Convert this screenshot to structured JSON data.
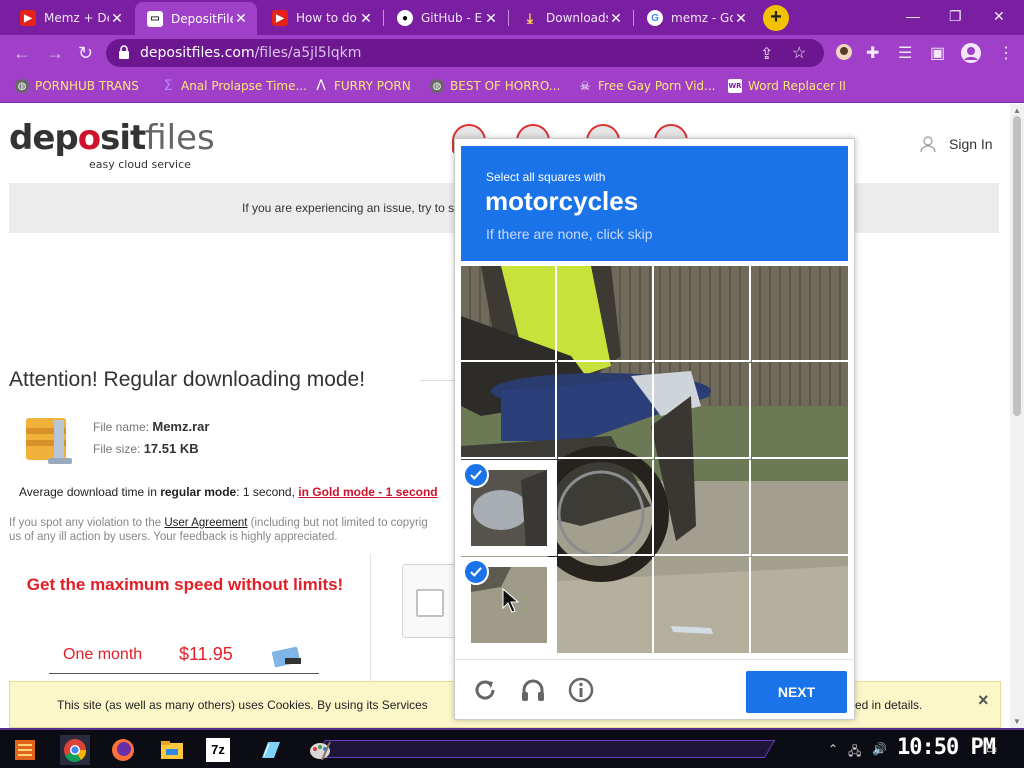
{
  "colors": {
    "chrome_purple": "#a040c8",
    "tabstrip_purple": "#7b1fa2",
    "bookmark_text": "#ffe57a",
    "captcha_blue": "#1a73e8",
    "accent_red": "#e21e26",
    "cookie_bg": "#fcf7c9"
  },
  "browser": {
    "tabs": [
      {
        "title": "Memz + De",
        "icon": "youtube-icon",
        "active": false
      },
      {
        "title": "DepositFile",
        "icon": "depositfiles-favicon",
        "active": true
      },
      {
        "title": "How to do",
        "icon": "youtube-icon",
        "active": false
      },
      {
        "title": "GitHub - E",
        "icon": "github-icon",
        "active": false
      },
      {
        "title": "Downloads",
        "icon": "download-icon",
        "active": false
      },
      {
        "title": "memz - Go",
        "icon": "google-icon",
        "active": false
      }
    ],
    "new_tab_label": "+",
    "url_host": "depositfiles.com",
    "url_path": "/files/a5jl5lqkm",
    "bookmarks": [
      {
        "label": "PORNHUB TRANS",
        "icon": "globe-icon"
      },
      {
        "label": "Anal Prolapse Time...",
        "icon": "sigma-icon"
      },
      {
        "label": "FURRY PORN",
        "icon": "lambda-icon"
      },
      {
        "label": "BEST OF HORRO...",
        "icon": "globe-icon"
      },
      {
        "label": "Free Gay Porn Vid...",
        "icon": "skull-icon"
      },
      {
        "label": "Word Replacer II",
        "icon": "wr-icon"
      }
    ]
  },
  "site": {
    "logo_part1": "dep",
    "logo_o": "o",
    "logo_part2": "sit",
    "logo_files": "files",
    "tagline": "easy cloud service",
    "sign_in": "Sign In",
    "issue_text": "If you are experiencing an issue, try to s",
    "attention": "Attention! Regular downloading mode!",
    "file_name_label": "File name:",
    "file_name": "Memz.rar",
    "file_size_label": "File size:",
    "file_size": "17.51 KB",
    "avg_prefix": "Average download time in ",
    "avg_mode": "regular mode",
    "avg_mid": ": 1 second, ",
    "avg_gold": "in Gold mode - 1 second",
    "violation_pre": "If you spot any violation to the ",
    "violation_link": "User Agreement",
    "violation_post": " (including but not limited to copyrig",
    "violation_line2": "us of any ill action by users. Your feedback is highly appreciated.",
    "max_speed": "Get the maximum speed without limits!",
    "plan_label": "One month",
    "plan_price": "$11.95",
    "cookie_text": "This site (as well as many others) uses Cookies. By using its Services",
    "cookie_text_end": "ed in details.",
    "cookie_close": "×"
  },
  "captcha": {
    "instruction": "Select all squares with",
    "target": "motorcycles",
    "hint": "If there are none, click skip",
    "selected_tiles": [
      8,
      12
    ],
    "next_label": "NEXT",
    "footer_icons": [
      "reload-icon",
      "audio-icon",
      "info-icon"
    ]
  },
  "taskbar": {
    "apps": [
      "start-icon",
      "chrome-icon",
      "firefox-icon",
      "explorer-icon",
      "7zip-icon",
      "notepad-icon",
      "paint-icon"
    ],
    "sevenzip_label": "7z",
    "clock": "10:50 PM"
  }
}
